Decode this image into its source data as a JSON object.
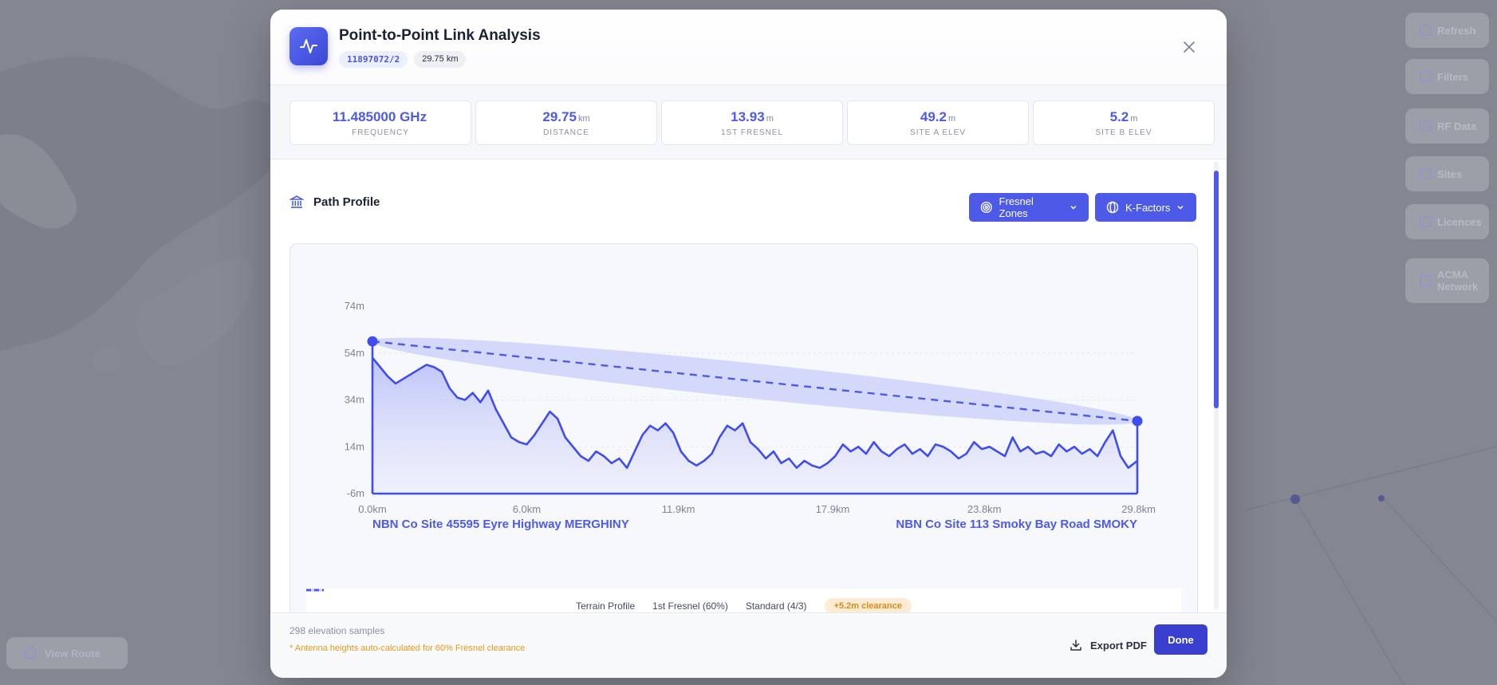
{
  "background": {
    "right_buttons": [
      "Refresh",
      "Filters",
      "RF Data",
      "Sites",
      "Licences",
      "ACMA Network"
    ],
    "view_route": "View Route"
  },
  "modal": {
    "title": "Point-to-Point Link Analysis",
    "link_id": "11897072/2",
    "distance_badge": "29.75 km",
    "stats": [
      {
        "value": "11.485000 GHz",
        "unit": "",
        "label": "FREQUENCY"
      },
      {
        "value": "29.75",
        "unit": "km",
        "label": "DISTANCE"
      },
      {
        "value": "13.93",
        "unit": "m",
        "label": "1ST FRESNEL"
      },
      {
        "value": "49.2",
        "unit": "m",
        "label": "SITE A ELEV"
      },
      {
        "value": "5.2",
        "unit": "m",
        "label": "SITE B ELEV"
      }
    ],
    "section_title": "Path Profile",
    "fresnel_dropdown": "Fresnel Zones",
    "kfactor_dropdown": "K-Factors",
    "legend": {
      "terrain": "Terrain Profile",
      "fresnel": "1st Fresnel (60%)",
      "standard": "Standard (4/3)",
      "clearance": "+5.2m clearance"
    },
    "footer": {
      "samples": "298 elevation samples",
      "note": "* Antenna heights auto-calculated for 60% Fresnel clearance",
      "export": "Export PDF",
      "done": "Done"
    }
  },
  "colors": {
    "accent": "#4d5ae8",
    "terrain_line": "#3f4df0",
    "fresnel_fill": "#c8cdfb",
    "clearance_text": "#d98a1a"
  },
  "chart_data": {
    "type": "area",
    "ylim": [
      -6,
      74
    ],
    "y_ticks": [
      "74m",
      "54m",
      "34m",
      "14m",
      "-6m"
    ],
    "x_ticks": [
      "0.0km",
      "6.0km",
      "11.9km",
      "17.9km",
      "23.8km",
      "29.8km"
    ],
    "xlim": [
      0,
      29.75
    ],
    "site_a": {
      "name": "NBN Co Site 45595 Eyre Highway MERGHINY",
      "x": 0,
      "antenna_y": 59
    },
    "site_b": {
      "name": "NBN Co Site 113 Smoky Bay Road SMOKY",
      "x": 29.75,
      "antenna_y": 25
    },
    "fresnel_radius_m": 7.5,
    "terrain": {
      "name": "Terrain Profile",
      "x": [
        0,
        0.3,
        0.6,
        0.9,
        1.2,
        1.5,
        1.8,
        2.1,
        2.4,
        2.7,
        3.0,
        3.3,
        3.6,
        3.9,
        4.2,
        4.5,
        4.8,
        5.1,
        5.4,
        5.7,
        6.0,
        6.3,
        6.6,
        6.9,
        7.2,
        7.5,
        7.8,
        8.1,
        8.4,
        8.7,
        9.0,
        9.3,
        9.6,
        9.9,
        10.2,
        10.5,
        10.8,
        11.1,
        11.4,
        11.7,
        12.0,
        12.3,
        12.6,
        12.9,
        13.2,
        13.5,
        13.8,
        14.1,
        14.4,
        14.7,
        15.0,
        15.3,
        15.6,
        15.9,
        16.2,
        16.5,
        16.8,
        17.1,
        17.4,
        17.7,
        18.0,
        18.3,
        18.6,
        18.9,
        19.2,
        19.5,
        19.8,
        20.1,
        20.4,
        20.7,
        21.0,
        21.3,
        21.6,
        21.9,
        22.2,
        22.5,
        22.8,
        23.1,
        23.4,
        23.7,
        24.0,
        24.3,
        24.6,
        24.9,
        25.2,
        25.5,
        25.8,
        26.1,
        26.4,
        26.7,
        27.0,
        27.3,
        27.6,
        27.9,
        28.2,
        28.5,
        28.8,
        29.1,
        29.4,
        29.75
      ],
      "y": [
        52,
        48,
        44,
        41,
        43,
        45,
        47,
        49,
        48,
        46,
        39,
        35,
        34,
        37,
        33,
        38,
        30,
        24,
        18,
        16,
        15,
        19,
        24,
        29,
        26,
        18,
        14,
        10,
        8,
        12,
        10,
        7,
        9,
        5,
        12,
        19,
        23,
        21,
        24,
        20,
        12,
        8,
        6,
        8,
        11,
        18,
        23,
        21,
        24,
        16,
        13,
        9,
        12,
        7,
        9,
        5,
        8,
        6,
        5,
        7,
        10,
        15,
        12,
        14,
        11,
        16,
        12,
        10,
        13,
        15,
        11,
        13,
        10,
        15,
        14,
        12,
        9,
        11,
        16,
        13,
        14,
        12,
        10,
        18,
        12,
        14,
        11,
        12,
        10,
        15,
        12,
        14,
        11,
        13,
        10,
        16,
        21,
        10,
        5,
        8
      ]
    }
  }
}
